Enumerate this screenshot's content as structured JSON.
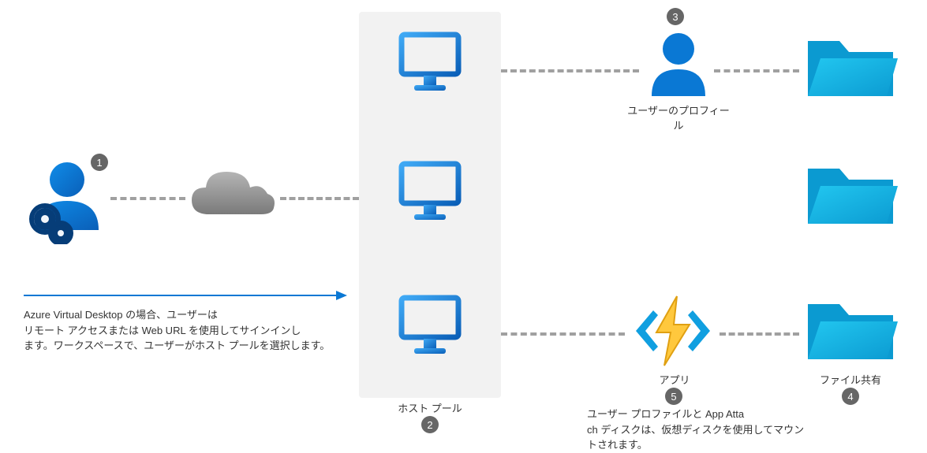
{
  "badges": {
    "user": "1",
    "hostpool": "2",
    "profile": "3",
    "fileshare": "4",
    "apps": "5"
  },
  "labels": {
    "hostpool": "ホスト プール",
    "profile": "ユーザーのプロフィール",
    "apps": "アプリ",
    "fileshare": "ファイル共有"
  },
  "captions": {
    "step1_line1": "Azure Virtual Desktop の場合、ユーザーは",
    "step1_line2": "リモート アクセスまたは Web URL を使用してサインインし",
    "step1_line3": "ます。ワークスペースで、ユーザーがホスト プールを選択します。",
    "step5_line1": "ユーザー プロファイルと App Atta",
    "step5_line2": "ch ディスクは、仮想ディスクを使用してマウン",
    "step5_line3": "トされます。"
  },
  "colors": {
    "primary": "#0a78d4",
    "folder": "#14b3e6",
    "lightning": "#ffc83d",
    "cloud": "#8e8e8e"
  }
}
